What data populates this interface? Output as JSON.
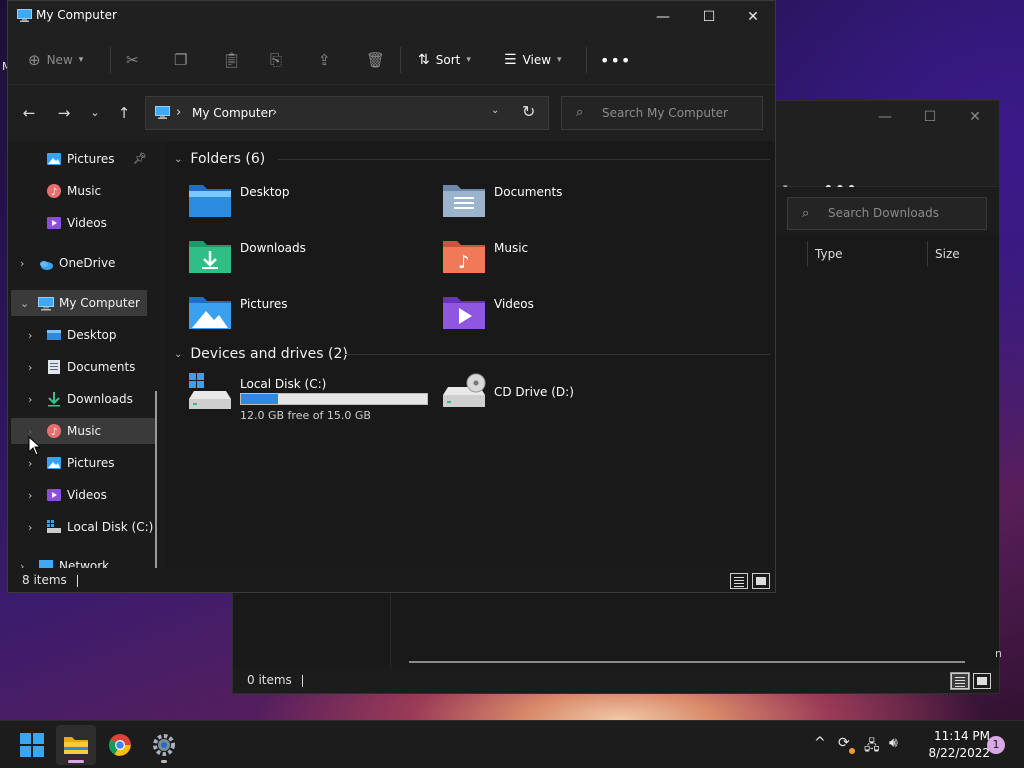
{
  "desktop": {
    "edge_label": "M"
  },
  "background_window": {
    "view_fragment": "v",
    "more_label": "•••",
    "search_placeholder": "Search Downloads",
    "columns": [
      "Type",
      "Size"
    ],
    "clipped_text": "n",
    "status_items": "0 items"
  },
  "window": {
    "title": "My Computer",
    "controls": {
      "minimize": "—",
      "maximize": "☐",
      "close": "✕"
    },
    "commandbar": {
      "new_label": "New",
      "sort_label": "Sort",
      "view_label": "View",
      "more_label": "•••"
    },
    "address": {
      "crumbs": [
        "My Computer"
      ],
      "search_placeholder": "Search My Computer"
    },
    "nav": {
      "quick_access": [
        {
          "label": "Pictures",
          "icon": "pictures-icon",
          "pinned": true
        },
        {
          "label": "Music",
          "icon": "music-icon"
        },
        {
          "label": "Videos",
          "icon": "videos-icon"
        }
      ],
      "onedrive": "OneDrive",
      "mycomputer": "My Computer",
      "children": [
        {
          "label": "Desktop",
          "icon": "desktop-folder-icon"
        },
        {
          "label": "Documents",
          "icon": "documents-icon"
        },
        {
          "label": "Downloads",
          "icon": "downloads-icon"
        },
        {
          "label": "Music",
          "icon": "music-icon"
        },
        {
          "label": "Pictures",
          "icon": "pictures-icon"
        },
        {
          "label": "Videos",
          "icon": "videos-icon"
        },
        {
          "label": "Local Disk (C:)",
          "icon": "local-disk-icon"
        }
      ],
      "network": "Network"
    },
    "folders_header": "Folders (6)",
    "folders": [
      {
        "label": "Desktop",
        "icon": "desktop-folder-icon"
      },
      {
        "label": "Documents",
        "icon": "documents-folder-icon"
      },
      {
        "label": "Downloads",
        "icon": "downloads-folder-icon"
      },
      {
        "label": "Music",
        "icon": "music-folder-icon"
      },
      {
        "label": "Pictures",
        "icon": "pictures-folder-icon"
      },
      {
        "label": "Videos",
        "icon": "videos-folder-icon"
      }
    ],
    "drives_header": "Devices and drives (2)",
    "drives": [
      {
        "label": "Local Disk (C:)",
        "free_text": "12.0 GB free of 15.0 GB",
        "used_fraction": 0.2
      },
      {
        "label": "CD Drive (D:)"
      }
    ],
    "status_items": "8 items"
  },
  "taskbar": {
    "apps": [
      "start-icon",
      "file-explorer-icon",
      "chrome-icon",
      "settings-icon"
    ],
    "tray_chevron": "^",
    "time": "11:14 PM",
    "date": "8/22/2022",
    "notification_count": "1"
  },
  "colors": {
    "accent": "#2b8be0",
    "window_bg": "#191919",
    "chrome": "#202020",
    "selection": "#3a3a3a"
  }
}
